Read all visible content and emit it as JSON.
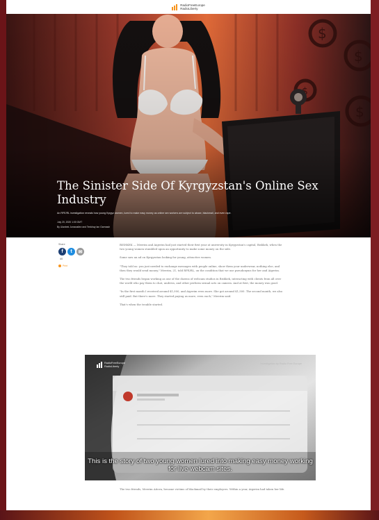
{
  "header": {
    "logo_line1": "RadioFreeEurope",
    "logo_line2": "RadioLiberty"
  },
  "hero": {
    "title": "The Sinister Side Of Kyrgyzstan's Online Sex Industry",
    "subtitle": "An RFE/RL investigation reveals how young Kyrgyz women, lured to make easy money as online sex workers are subject to abuse, blackmail, and even rape.",
    "date": "July 20, 2020 1:00 GMT",
    "byline": "By Ulanbek Jumanaliev and Tenkhay Ian Garmash"
  },
  "share": {
    "label": "Share",
    "facebook": "f",
    "twitter": "t",
    "email": "✉",
    "count": "40",
    "print": "Print"
  },
  "article": {
    "paragraphs": [
      "BISHKEK — Meerim and Aigerim had just started their first year at university in Kyrgyzstan's capital, Bishkek, when the two young women stumbled upon an opportunity to make some money on the side.",
      "Some saw an ad on Kyrgyzstan looking for young, attractive women.",
      "\"They told us: you just needed to exchange messages with people online, show them your underwear, nothing else, and then they would send money,\" Meerim, 21, told RFE/RL, on the condition that we use pseudonyms for her and Aigerim.",
      "The two friends began working as one of the dozens of webcam studios in Bishkek, interacting with clients from all over the world who pay them to chat, undress, and other perform sexual acts on camera. And at first, the money was good.",
      "\"In the first month I received around $1,000, and Aigerim even more. She got around $1,500. The second month, we also still paid. But there's more. They started paying us more, even each,\" Meerim said.",
      "That's when the trouble started."
    ],
    "after": "The two friends, Meerim Aitova, became victims of blackmail by their employers. Within a year, Aigerim had taken her life."
  },
  "video": {
    "logo_line1": "RadioFreeEurope",
    "logo_line2": "RadioLiberty",
    "watermark": "Investigation by Radio Free Europe",
    "caption": "This is the story of two young women lured into making easy money working for live webcam sites."
  },
  "colors": {
    "accent": "#f7941d",
    "frame": "#7a1a1f",
    "facebook": "#1d3f73",
    "twitter": "#1f8de0"
  }
}
